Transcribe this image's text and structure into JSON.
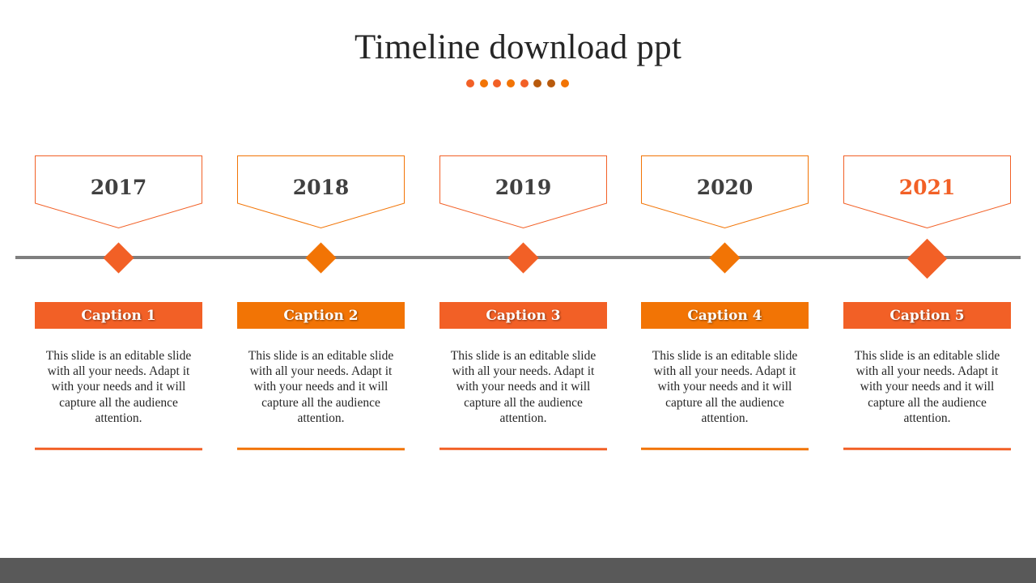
{
  "slide": {
    "title": "Timeline download ppt",
    "colors": {
      "accent_red_orange": "#F26026",
      "accent_orange": "#F27405",
      "accent_brown": "#B85A0C",
      "timeline_gray": "#7F7F7F",
      "text_dark": "#404040",
      "footer_gray": "#595959"
    },
    "title_dots": [
      "#F26026",
      "#F27405",
      "#F26026",
      "#F27405",
      "#F26026",
      "#B85A0C",
      "#B85A0C",
      "#F27405"
    ],
    "milestones": [
      {
        "year": "2017",
        "year_color": "#404040",
        "accent": "#F26026",
        "highlighted": false,
        "caption": "Caption 1",
        "body": "This slide is an editable slide with all your needs. Adapt it with your needs and it will capture all the audience attention."
      },
      {
        "year": "2018",
        "year_color": "#404040",
        "accent": "#F27405",
        "highlighted": false,
        "caption": "Caption 2",
        "body": "This slide is an editable slide with all your needs. Adapt it with your needs and it will capture all the audience attention."
      },
      {
        "year": "2019",
        "year_color": "#404040",
        "accent": "#F26026",
        "highlighted": false,
        "caption": "Caption 3",
        "body": "This slide is an editable slide with all your needs. Adapt it with your needs and it will capture all the audience attention."
      },
      {
        "year": "2020",
        "year_color": "#404040",
        "accent": "#F27405",
        "highlighted": false,
        "caption": "Caption 4",
        "body": "This slide is an editable slide with all your needs. Adapt it with your needs and it will capture all the audience attention."
      },
      {
        "year": "2021",
        "year_color": "#F26026",
        "accent": "#F26026",
        "highlighted": true,
        "caption": "Caption 5",
        "body": "This slide is an editable slide with all your needs. Adapt it with your needs and it will capture all the audience attention."
      }
    ]
  }
}
